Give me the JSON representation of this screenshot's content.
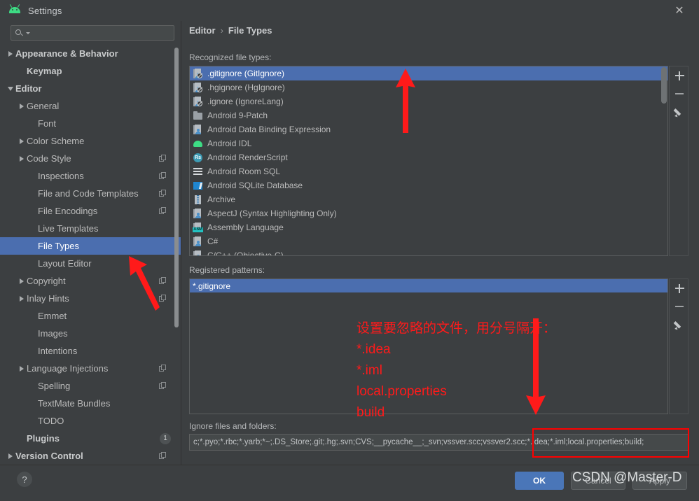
{
  "window": {
    "title": "Settings",
    "app_icon": "android-logo-icon",
    "close_icon": "close-icon"
  },
  "search": {
    "value": "",
    "placeholder": "",
    "icon": "search-icon"
  },
  "sidebar": {
    "items": [
      {
        "label": "Appearance & Behavior",
        "arrow": "right",
        "indent": 0,
        "bold": true,
        "selected": false,
        "badge": ""
      },
      {
        "label": "Keymap",
        "arrow": "none",
        "indent": 1,
        "bold": true,
        "selected": false,
        "badge": ""
      },
      {
        "label": "Editor",
        "arrow": "down",
        "indent": 0,
        "bold": true,
        "selected": false,
        "badge": ""
      },
      {
        "label": "General",
        "arrow": "right",
        "indent": 1,
        "bold": false,
        "selected": false,
        "badge": ""
      },
      {
        "label": "Font",
        "arrow": "none",
        "indent": 2,
        "bold": false,
        "selected": false,
        "badge": ""
      },
      {
        "label": "Color Scheme",
        "arrow": "right",
        "indent": 1,
        "bold": false,
        "selected": false,
        "badge": ""
      },
      {
        "label": "Code Style",
        "arrow": "right",
        "indent": 1,
        "bold": false,
        "selected": false,
        "badge": "copy"
      },
      {
        "label": "Inspections",
        "arrow": "none",
        "indent": 2,
        "bold": false,
        "selected": false,
        "badge": "copy"
      },
      {
        "label": "File and Code Templates",
        "arrow": "none",
        "indent": 2,
        "bold": false,
        "selected": false,
        "badge": "copy"
      },
      {
        "label": "File Encodings",
        "arrow": "none",
        "indent": 2,
        "bold": false,
        "selected": false,
        "badge": "copy"
      },
      {
        "label": "Live Templates",
        "arrow": "none",
        "indent": 2,
        "bold": false,
        "selected": false,
        "badge": ""
      },
      {
        "label": "File Types",
        "arrow": "none",
        "indent": 2,
        "bold": false,
        "selected": true,
        "badge": ""
      },
      {
        "label": "Layout Editor",
        "arrow": "none",
        "indent": 2,
        "bold": false,
        "selected": false,
        "badge": ""
      },
      {
        "label": "Copyright",
        "arrow": "right",
        "indent": 1,
        "bold": false,
        "selected": false,
        "badge": "copy"
      },
      {
        "label": "Inlay Hints",
        "arrow": "right",
        "indent": 1,
        "bold": false,
        "selected": false,
        "badge": "copy"
      },
      {
        "label": "Emmet",
        "arrow": "none",
        "indent": 2,
        "bold": false,
        "selected": false,
        "badge": ""
      },
      {
        "label": "Images",
        "arrow": "none",
        "indent": 2,
        "bold": false,
        "selected": false,
        "badge": ""
      },
      {
        "label": "Intentions",
        "arrow": "none",
        "indent": 2,
        "bold": false,
        "selected": false,
        "badge": ""
      },
      {
        "label": "Language Injections",
        "arrow": "right",
        "indent": 1,
        "bold": false,
        "selected": false,
        "badge": "copy"
      },
      {
        "label": "Spelling",
        "arrow": "none",
        "indent": 2,
        "bold": false,
        "selected": false,
        "badge": "copy"
      },
      {
        "label": "TextMate Bundles",
        "arrow": "none",
        "indent": 2,
        "bold": false,
        "selected": false,
        "badge": ""
      },
      {
        "label": "TODO",
        "arrow": "none",
        "indent": 2,
        "bold": false,
        "selected": false,
        "badge": ""
      },
      {
        "label": "Plugins",
        "arrow": "none",
        "indent": 1,
        "bold": true,
        "selected": false,
        "badge": "1"
      },
      {
        "label": "Version Control",
        "arrow": "right",
        "indent": 0,
        "bold": true,
        "selected": false,
        "badge": "copy"
      }
    ]
  },
  "breadcrumb": {
    "parent": "Editor",
    "separator": "›",
    "current": "File Types"
  },
  "main": {
    "recognized_label": "Recognized file types:",
    "patterns_label": "Registered patterns:",
    "ignore_label": "Ignore files and folders:",
    "file_types": [
      {
        "name": ".gitignore (GitIgnore)",
        "icon": "ignore-file-icon",
        "selected": true
      },
      {
        "name": ".hgignore (HgIgnore)",
        "icon": "ignore-file-icon",
        "selected": false
      },
      {
        "name": ".ignore (IgnoreLang)",
        "icon": "ignore-file-icon",
        "selected": false
      },
      {
        "name": "Android 9-Patch",
        "icon": "folder-icon",
        "selected": false
      },
      {
        "name": "Android Data Binding Expression",
        "icon": "generic-file-icon",
        "selected": false
      },
      {
        "name": "Android IDL",
        "icon": "android-icon",
        "selected": false
      },
      {
        "name": "Android RenderScript",
        "icon": "renderscript-icon",
        "selected": false
      },
      {
        "name": "Android Room SQL",
        "icon": "sql-lines-icon",
        "selected": false
      },
      {
        "name": "Android SQLite Database",
        "icon": "sqlite-icon",
        "selected": false
      },
      {
        "name": "Archive",
        "icon": "archive-icon",
        "selected": false
      },
      {
        "name": "AspectJ (Syntax Highlighting Only)",
        "icon": "generic-file-icon",
        "selected": false
      },
      {
        "name": "Assembly Language",
        "icon": "asm-icon",
        "selected": false
      },
      {
        "name": "C#",
        "icon": "generic-file-icon",
        "selected": false
      },
      {
        "name": "C/C++ (Objective-C)",
        "icon": "generic-file-icon",
        "selected": false
      }
    ],
    "patterns": [
      {
        "name": "*.gitignore",
        "selected": true
      }
    ],
    "ignore_value": "c;*.pyo;*.rbc;*.yarb;*~;.DS_Store;.git;.hg;.svn;CVS;__pycache__;_svn;vssver.scc;vssver2.scc;*.idea;*.iml;local.properties;build;"
  },
  "toolbars": {
    "add_icon": "plus-icon",
    "remove_icon": "minus-icon",
    "edit_icon": "pencil-icon"
  },
  "footer": {
    "ok_label": "OK",
    "cancel_label": "Cancel",
    "apply_label": "Apply",
    "help_label": "?"
  },
  "annotations": {
    "note_lines": "设置要忽略的文件，用分号隔开：\n*.idea\n*.iml\nlocal.properties\nbuild",
    "accent_color": "#ff1a1a",
    "watermark": "CSDN @Master-D"
  },
  "colors": {
    "window_bg": "#3c3f41",
    "selection_blue": "#4b6eaf",
    "ok_button": "#4a76b8",
    "text": "#bbbbbb",
    "annotation_red": "#ff1a1a"
  }
}
